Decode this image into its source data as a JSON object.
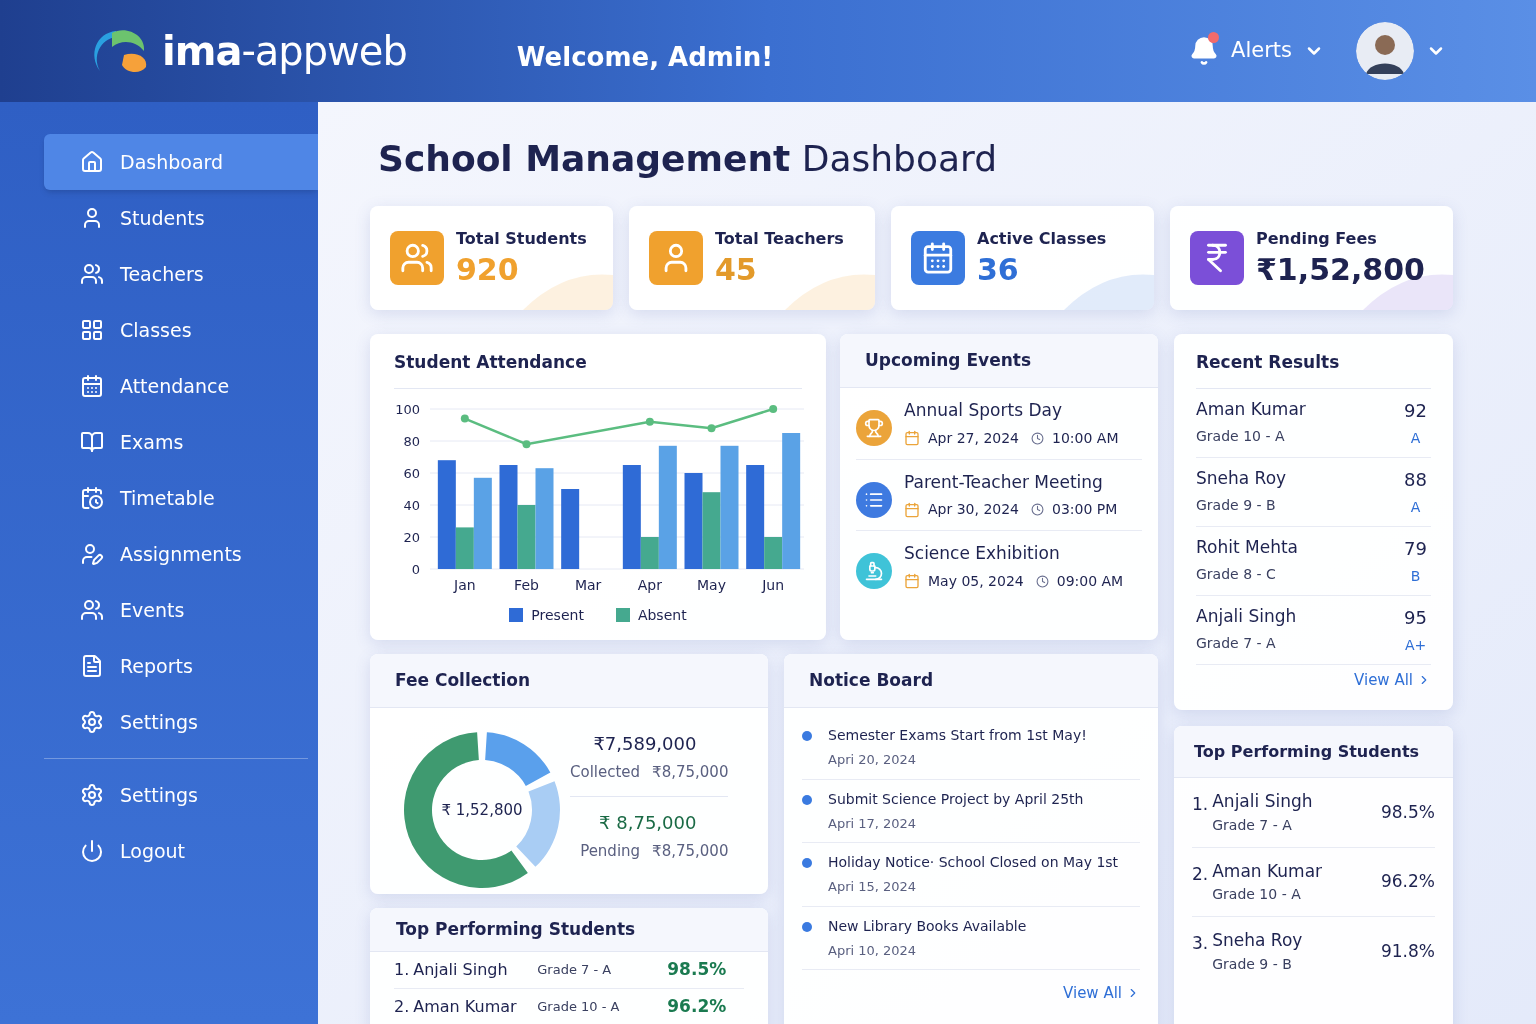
{
  "header": {
    "logo_text": "**ima**-appweb",
    "welcome": "Welcome, Admin!",
    "alerts": {
      "label": "Alerts",
      "has_unread": true
    }
  },
  "sidebar": {
    "items": [
      {
        "label": "Dashboard",
        "selected": true
      },
      {
        "label": "Students",
        "selected": false
      },
      {
        "label": "Teachers",
        "selected": false
      },
      {
        "label": "Classes",
        "selected": false
      },
      {
        "label": "Attendance",
        "selected": false
      },
      {
        "label": "Exams",
        "selected": false
      },
      {
        "label": "Timetable",
        "selected": false
      },
      {
        "label": "Assignments",
        "selected": false
      },
      {
        "label": "Events",
        "selected": false
      },
      {
        "label": "Reports",
        "selected": false
      },
      {
        "label": "Settings",
        "selected": false
      }
    ],
    "footer_items": [
      {
        "label": "Settings",
        "selected": false
      },
      {
        "label": "Logout",
        "selected": false
      }
    ]
  },
  "page_title": "**School Management** Dashboard",
  "stats": [
    {
      "label": "Total Students",
      "value": "920",
      "color": "#f0a12e"
    },
    {
      "label": "Total Teachers",
      "value": "45",
      "color": "#e39a2a"
    },
    {
      "label": "Active Classes",
      "value": "36",
      "color": "#2f6fd6"
    },
    {
      "label": "Pending Fees",
      "value": "₹1,52,800",
      "color": "#1e2350"
    }
  ],
  "attendance": {
    "title": "Student Attendance",
    "chart_data": {
      "type": "bar",
      "stacked": false,
      "grid": true,
      "legend": "bottom",
      "categories": [
        "Jan",
        "Feb",
        "Mar",
        "Apr",
        "May",
        "Jun"
      ],
      "ylim": [
        0,
        100
      ],
      "yticks": [
        0,
        20,
        40,
        60,
        80,
        100
      ],
      "series": [
        {
          "name": "Present",
          "color": "#2f6bd6",
          "values": [
            68,
            65,
            50,
            65,
            60,
            65
          ]
        },
        {
          "name": "Absent",
          "color": "#45a98f",
          "values": [
            26,
            40,
            null,
            20,
            48,
            20
          ]
        },
        {
          "color": "#5aa2e6",
          "values": [
            57,
            63,
            null,
            77,
            77,
            85
          ]
        },
        {
          "type": "line",
          "marker": "circle",
          "color": "#5bbd80",
          "values": [
            94,
            78,
            null,
            92,
            88,
            100
          ]
        }
      ]
    }
  },
  "events": {
    "title": "Upcoming Events",
    "items": [
      {
        "title": "Annual Sports Day",
        "date": "Apr 27, 2024",
        "time": "10:00 AM",
        "color": "#eba43a"
      },
      {
        "title": "Parent-Teacher Meeting",
        "date": "Apr 30, 2024",
        "time": "03:00 PM",
        "color": "#3e7ae0"
      },
      {
        "title": "Science Exhibition",
        "date": "May 05, 2024",
        "time": "09:00 AM",
        "color": "#3fc3d8"
      }
    ]
  },
  "recent_results": {
    "title": "Recent Results",
    "rows": [
      {
        "name": "Aman Kumar",
        "grade": "Grade 10 - A",
        "score": "92",
        "letter": "A"
      },
      {
        "name": "Sneha Roy",
        "grade": "Grade 9 - B",
        "score": "88",
        "letter": "A"
      },
      {
        "name": "Rohit Mehta",
        "grade": "Grade 8 - C",
        "score": "79",
        "letter": "B"
      },
      {
        "name": "Anjali Singh",
        "grade": "Grade 7 - A",
        "score": "95",
        "letter": "A+"
      }
    ],
    "view_all": "View All"
  },
  "fee_collection": {
    "title": "Fee Collection",
    "center": "₹ 1,52,800",
    "collected_amount": "₹7,589,000",
    "collected_label": "Collected",
    "collected_total": "₹8,75,000",
    "pending_amount": "₹ 8,75,000",
    "pending_label": "Pending",
    "pending_total": "₹8,75,000"
  },
  "notice_board": {
    "title": "Notice Board",
    "items": [
      {
        "text": "Semester Exams Start from 1st May!",
        "date": "Apri 20, 2024"
      },
      {
        "text": "Submit Science Project by April 25th",
        "date": "Apri 17, 2024"
      },
      {
        "text": "Holiday Notice· School Closed on May 1st",
        "date": "Apri 15, 2024"
      },
      {
        "text": "New Library Books Available",
        "date": "Apri 10, 2024"
      }
    ],
    "view_all": "View All"
  },
  "top_students_bottom": {
    "title": "Top Performing Students",
    "rows": [
      {
        "rank": "1.",
        "name": "Anjali Singh",
        "grade": "Grade 7 - A",
        "percent": "98.5%"
      },
      {
        "rank": "2.",
        "name": "Aman Kumar",
        "grade": "Grade 10 - A",
        "percent": "96.2%"
      }
    ]
  },
  "top_students_right": {
    "title": "Top Performing Students",
    "rows": [
      {
        "rank": "1.",
        "name": "Anjali Singh",
        "grade": "Grade 7 - A",
        "percent": "98.5%"
      },
      {
        "rank": "2.",
        "name": "Aman Kumar",
        "grade": "Grade 10 - A",
        "percent": "96.2%"
      },
      {
        "rank": "3.",
        "name": "Sneha Roy",
        "grade": "Grade 9 - B",
        "percent": "91.8%"
      }
    ]
  }
}
